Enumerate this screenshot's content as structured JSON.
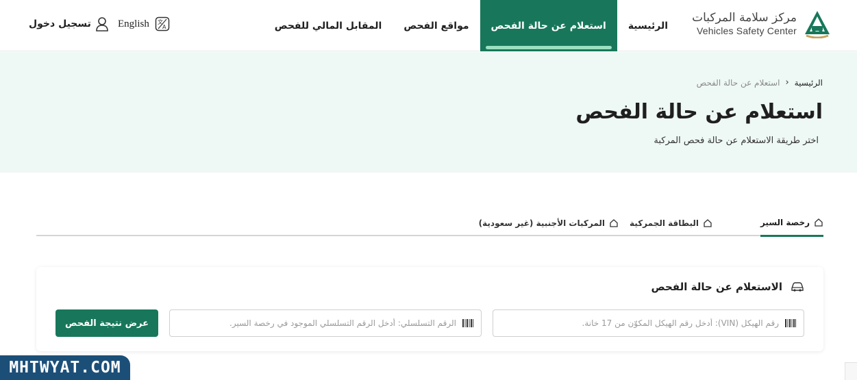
{
  "brand": {
    "name_ar": "مركز سلامة المركبات",
    "name_en": "Vehicles Safety Center",
    "accent": "#18775a",
    "logo_icon": "vehicle-safety-logo"
  },
  "nav": {
    "items": [
      {
        "label": "الرئيسية",
        "active": false
      },
      {
        "label": "استعلام عن حالة الفحص",
        "active": true
      },
      {
        "label": "مواقع الفحص",
        "active": false
      },
      {
        "label": "المقابل المالي للفحص",
        "active": false
      }
    ],
    "language_label": "English",
    "language_icon": "translate-icon",
    "login_label": "تسجيل دخول",
    "login_icon": "user-icon"
  },
  "hero": {
    "breadcrumb_home": "الرئيسية",
    "breadcrumb_current": "استعلام عن حالة الفحص",
    "title": "استعلام عن حالة الفحص",
    "subtitle": "اختر طريقة الاستعلام عن حالة فحص المركبة",
    "background": "#eef8f4"
  },
  "tabs": [
    {
      "label": "رخصة السير",
      "active": true,
      "icon": "home-icon"
    },
    {
      "label": "البطاقة الجمركية",
      "active": false,
      "icon": "home-icon"
    },
    {
      "label": "المركبات الأجنبية (غير سعودية)",
      "active": false,
      "icon": "home-icon"
    }
  ],
  "form": {
    "title": "الاستعلام عن حالة الفحص",
    "title_icon": "car-icon",
    "vin_placeholder": "رقم الهيكل (VIN): أدخل رقم الهيكل المكوّن من 17 خانة.",
    "serial_placeholder": "الرقم التسلسلي: أدخل الرقم التسلسلي الموجود في رخصة السير.",
    "field_icon": "barcode-icon",
    "submit_label": "عرض نتيجة الفحص"
  },
  "watermark": {
    "text": "MHTWYAT.COM"
  }
}
